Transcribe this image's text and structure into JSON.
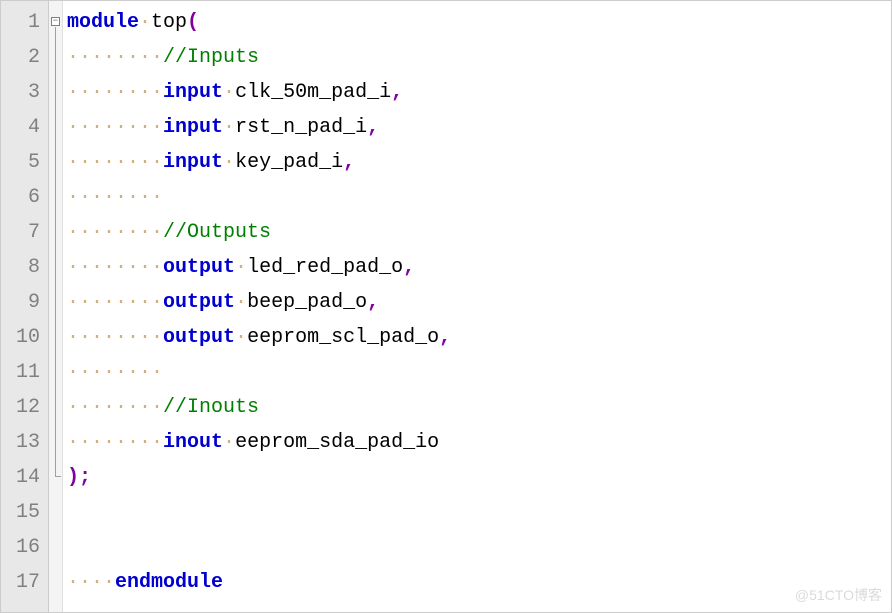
{
  "editor": {
    "lineCount": 17,
    "foldStart": 1,
    "foldEnd": 14,
    "lines": [
      {
        "num": "1",
        "tokens": [
          {
            "cls": "kw",
            "t": "module"
          },
          {
            "cls": "pl",
            "t": " top"
          },
          {
            "cls": "op",
            "t": "("
          }
        ]
      },
      {
        "num": "2",
        "indent": 2,
        "tokens": [
          {
            "cls": "cm",
            "t": "//Inputs"
          }
        ]
      },
      {
        "num": "3",
        "indent": 2,
        "tokens": [
          {
            "cls": "kw",
            "t": "input"
          },
          {
            "cls": "pl",
            "t": " clk_50m_pad_i"
          },
          {
            "cls": "op",
            "t": ","
          }
        ]
      },
      {
        "num": "4",
        "indent": 2,
        "tokens": [
          {
            "cls": "kw",
            "t": "input"
          },
          {
            "cls": "pl",
            "t": " rst_n_pad_i"
          },
          {
            "cls": "op",
            "t": ","
          }
        ]
      },
      {
        "num": "5",
        "indent": 2,
        "tokens": [
          {
            "cls": "kw",
            "t": "input"
          },
          {
            "cls": "pl",
            "t": " key_pad_i"
          },
          {
            "cls": "op",
            "t": ","
          }
        ]
      },
      {
        "num": "6",
        "indent": 2,
        "tokens": []
      },
      {
        "num": "7",
        "indent": 2,
        "tokens": [
          {
            "cls": "cm",
            "t": "//Outputs"
          }
        ]
      },
      {
        "num": "8",
        "indent": 2,
        "tokens": [
          {
            "cls": "kw",
            "t": "output"
          },
          {
            "cls": "pl",
            "t": " led_red_pad_o"
          },
          {
            "cls": "op",
            "t": ","
          }
        ]
      },
      {
        "num": "9",
        "indent": 2,
        "tokens": [
          {
            "cls": "kw",
            "t": "output"
          },
          {
            "cls": "pl",
            "t": " beep_pad_o"
          },
          {
            "cls": "op",
            "t": ","
          }
        ]
      },
      {
        "num": "10",
        "indent": 2,
        "tokens": [
          {
            "cls": "kw",
            "t": "output"
          },
          {
            "cls": "pl",
            "t": " eeprom_scl_pad_o"
          },
          {
            "cls": "op",
            "t": ","
          }
        ]
      },
      {
        "num": "11",
        "indent": 2,
        "tokens": []
      },
      {
        "num": "12",
        "indent": 2,
        "tokens": [
          {
            "cls": "cm",
            "t": "//Inouts"
          }
        ]
      },
      {
        "num": "13",
        "indent": 2,
        "tokens": [
          {
            "cls": "kw",
            "t": "inout"
          },
          {
            "cls": "pl",
            "t": " eeprom_sda_pad_io"
          }
        ]
      },
      {
        "num": "14",
        "indent": 0,
        "tokens": [
          {
            "cls": "op",
            "t": ");"
          }
        ]
      },
      {
        "num": "15",
        "indent": 0,
        "tokens": []
      },
      {
        "num": "16",
        "indent": 0,
        "tokens": []
      },
      {
        "num": "17",
        "indent": 1,
        "tokens": [
          {
            "cls": "kw",
            "t": "endmodule"
          }
        ]
      }
    ]
  },
  "whitespace_glyph": "····",
  "fold_glyph": "−",
  "watermark": "@51CTO博客"
}
